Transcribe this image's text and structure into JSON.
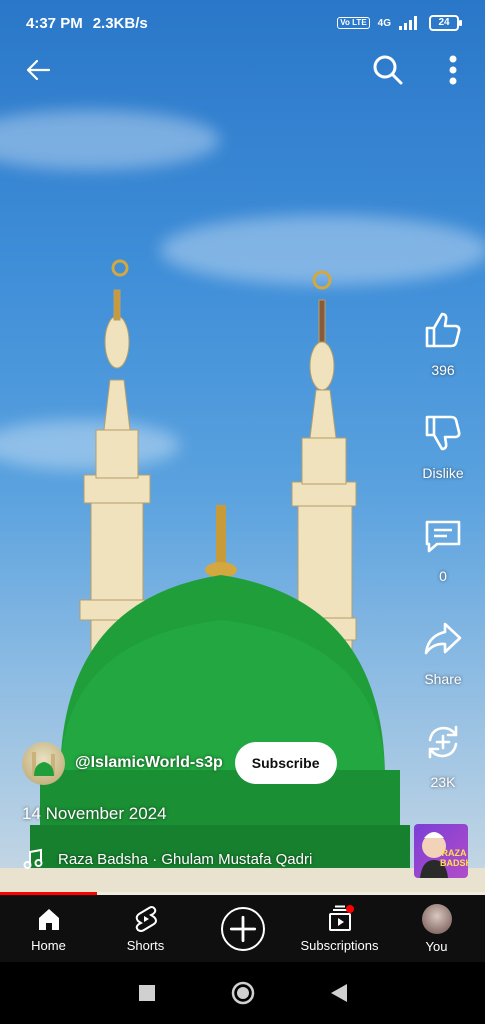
{
  "status_bar": {
    "time": "4:37 PM",
    "speed": "2.3KB/s",
    "volte": "Vo LTE",
    "network": "4G",
    "battery": "24"
  },
  "channel": {
    "handle": "@IslamicWorld-s3p",
    "subscribe_label": "Subscribe"
  },
  "date": "14 November 2024",
  "music": {
    "track": "Raza Badsha · Ghulam Mustafa Qadri",
    "thumb_text": "RAZA BADSHA"
  },
  "actions": {
    "like_count": "396",
    "dislike_label": "Dislike",
    "comment_count": "0",
    "share_label": "Share",
    "remix_count": "23K"
  },
  "progress": 0.2,
  "nav": {
    "home": "Home",
    "shorts": "Shorts",
    "subscriptions": "Subscriptions",
    "you": "You"
  },
  "colors": {
    "accent": "#ff0000",
    "dome": "#1f9e3a",
    "nav_bg": "#0f0f0f"
  }
}
